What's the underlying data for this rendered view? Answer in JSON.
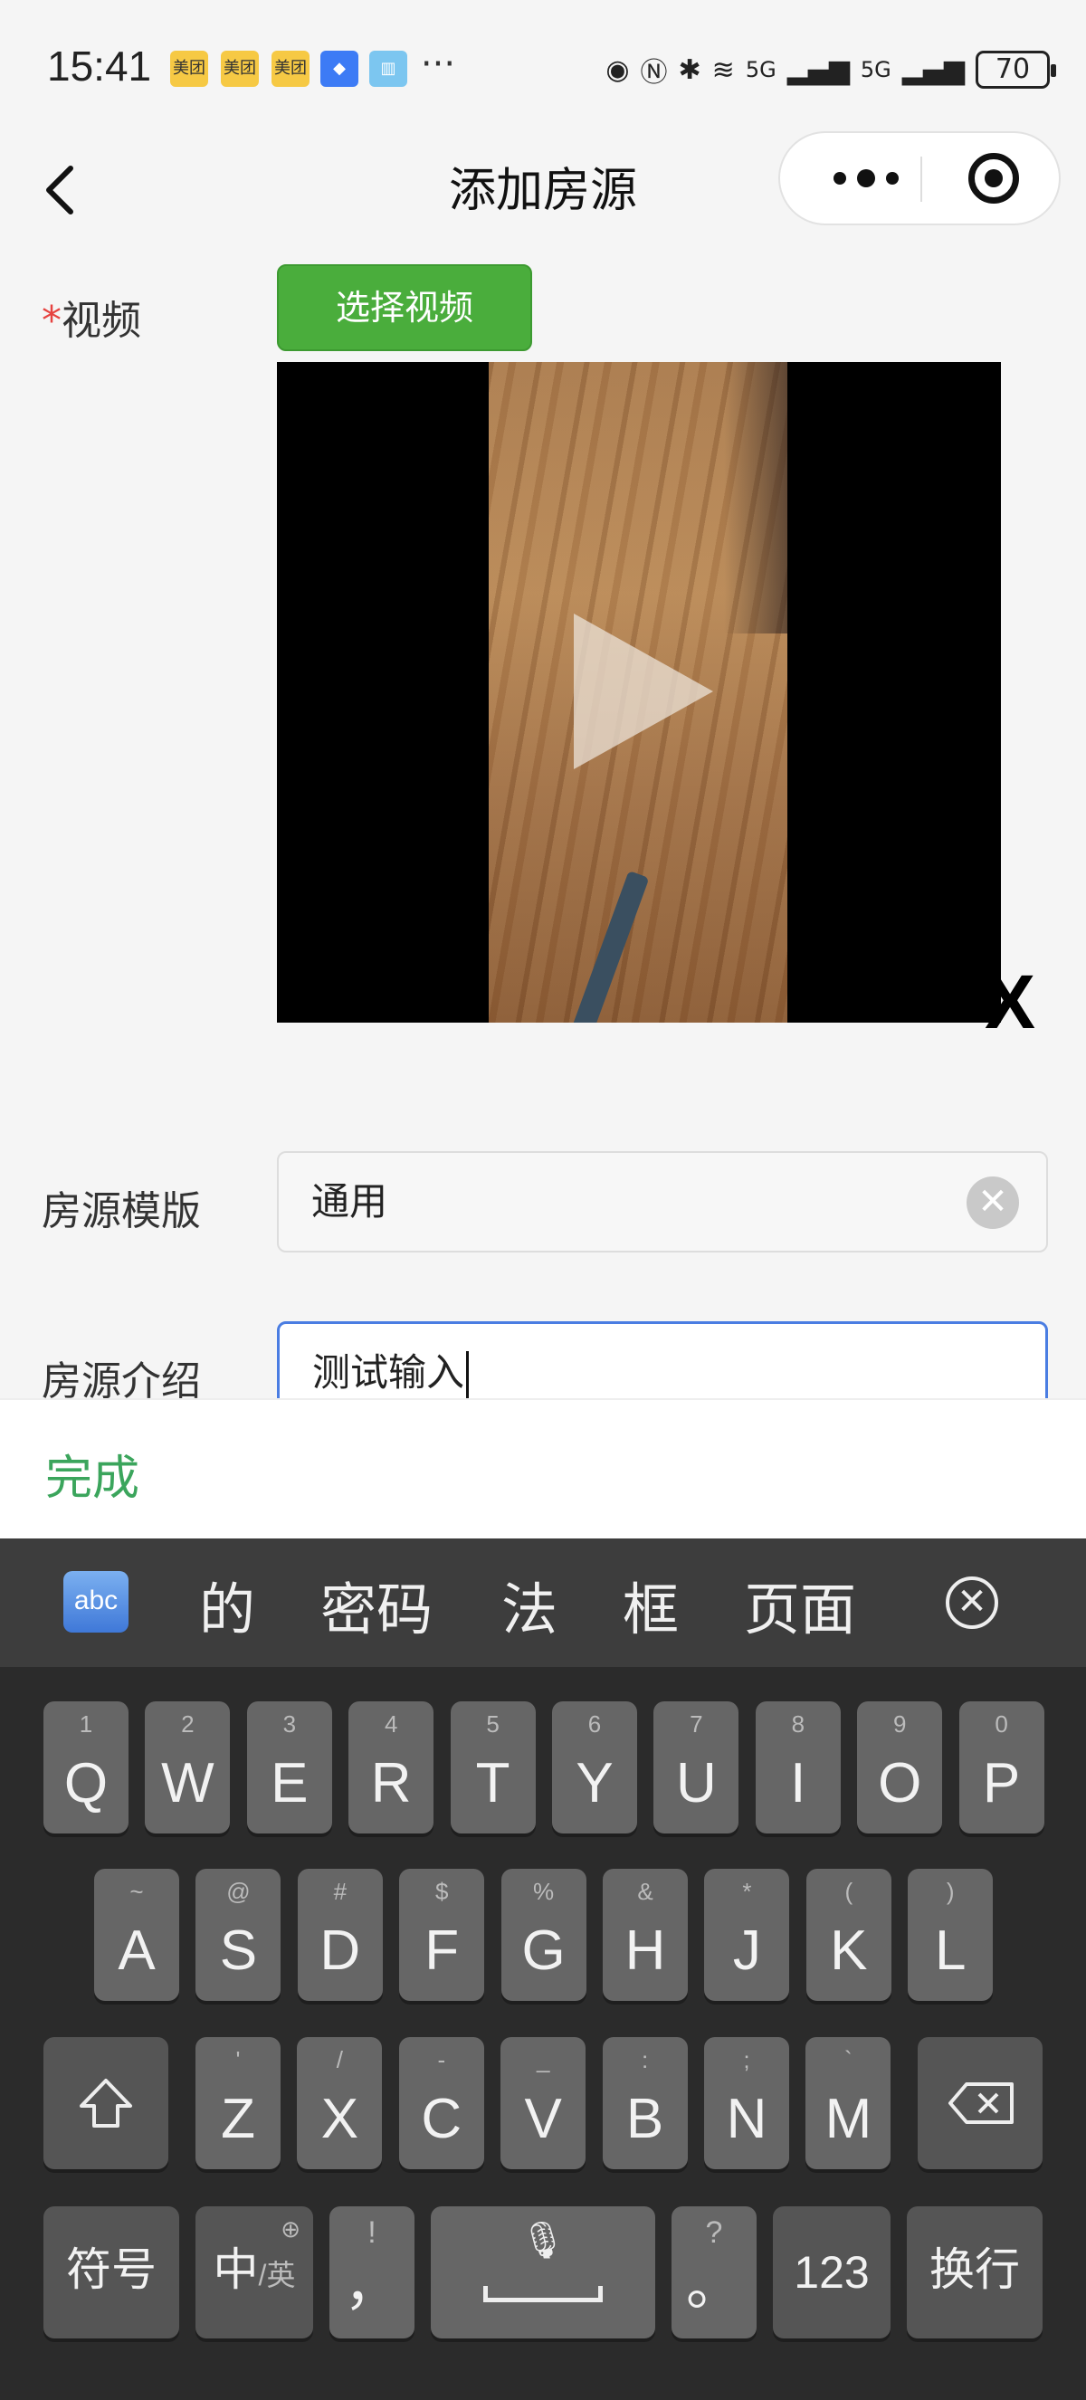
{
  "status_bar": {
    "time": "15:41",
    "notifications": [
      "美团",
      "美团",
      "美团"
    ],
    "battery": "70",
    "network": "5G"
  },
  "nav": {
    "title": "添加房源",
    "back_icon": "chevron-left-icon",
    "more_icon": "more-dots-icon",
    "close_icon": "target-icon"
  },
  "form": {
    "video": {
      "required_mark": "*",
      "label": "视频",
      "select_button": "选择视频",
      "remove_label": "X"
    },
    "template": {
      "label": "房源模版",
      "value": "通用"
    },
    "intro": {
      "label": "房源介绍",
      "value": "测试输入"
    }
  },
  "accessory": {
    "done": "完成"
  },
  "keyboard": {
    "mode_label": "abc",
    "candidates": [
      "的",
      "密码",
      "法",
      "框",
      "页面"
    ],
    "row1": [
      {
        "k": "Q",
        "s": "1"
      },
      {
        "k": "W",
        "s": "2"
      },
      {
        "k": "E",
        "s": "3"
      },
      {
        "k": "R",
        "s": "4"
      },
      {
        "k": "T",
        "s": "5"
      },
      {
        "k": "Y",
        "s": "6"
      },
      {
        "k": "U",
        "s": "7"
      },
      {
        "k": "I",
        "s": "8"
      },
      {
        "k": "O",
        "s": "9"
      },
      {
        "k": "P",
        "s": "0"
      }
    ],
    "row2": [
      {
        "k": "A",
        "s": "~"
      },
      {
        "k": "S",
        "s": "@"
      },
      {
        "k": "D",
        "s": "#"
      },
      {
        "k": "F",
        "s": "$"
      },
      {
        "k": "G",
        "s": "%"
      },
      {
        "k": "H",
        "s": "&"
      },
      {
        "k": "J",
        "s": "*"
      },
      {
        "k": "K",
        "s": "("
      },
      {
        "k": "L",
        "s": ")"
      }
    ],
    "row3": [
      {
        "k": "Z",
        "s": "'"
      },
      {
        "k": "X",
        "s": "/"
      },
      {
        "k": "C",
        "s": "-"
      },
      {
        "k": "V",
        "s": "_"
      },
      {
        "k": "B",
        "s": ":"
      },
      {
        "k": "N",
        "s": ";"
      },
      {
        "k": "M",
        "s": "`"
      }
    ],
    "symbols": "符号",
    "lang_main": "中",
    "lang_sub": "/英",
    "comma": "，",
    "comma_sub": "!",
    "period": "。",
    "period_sub": "?",
    "num": "123",
    "enter": "换行"
  }
}
